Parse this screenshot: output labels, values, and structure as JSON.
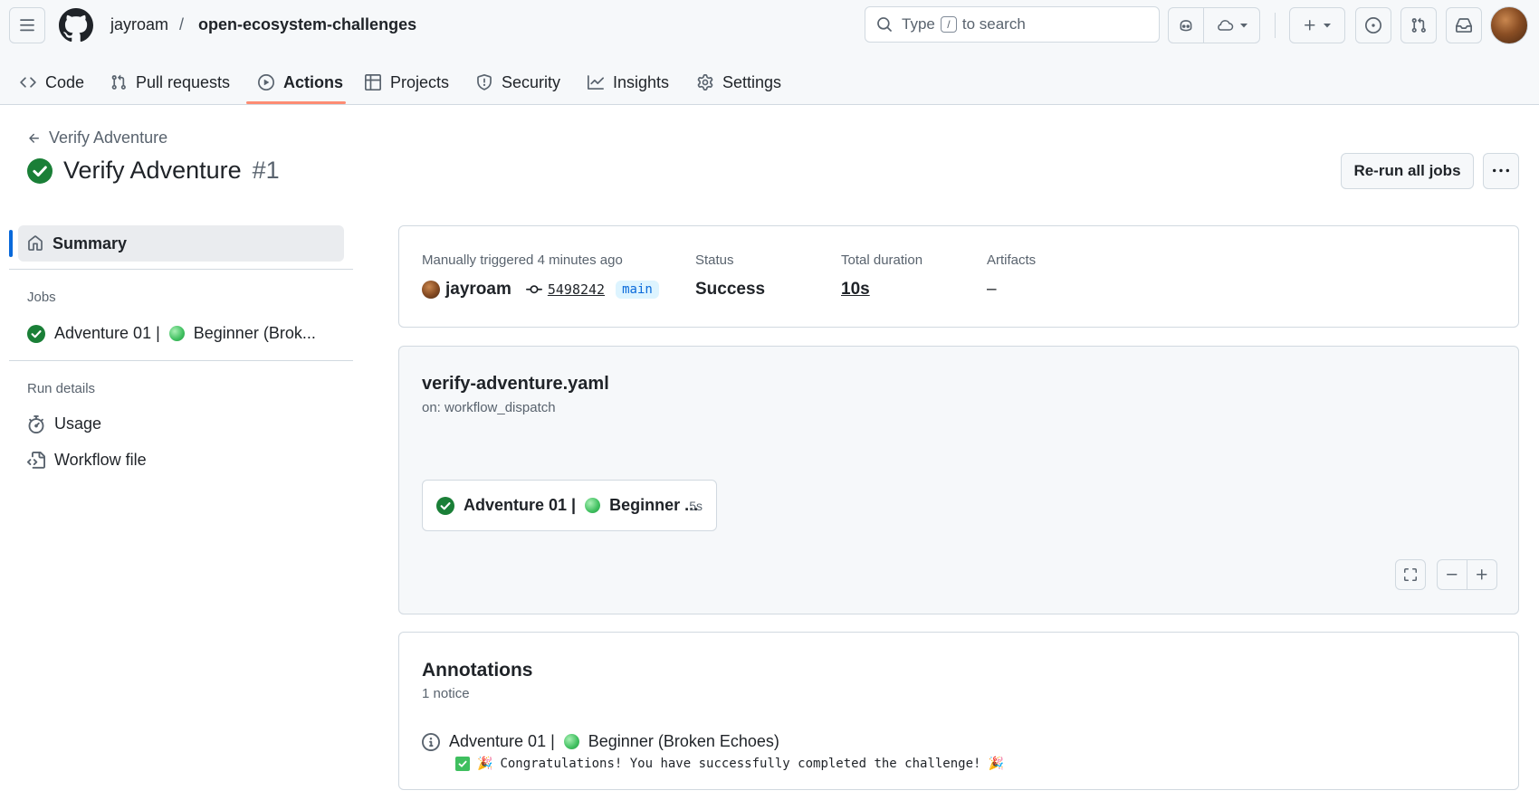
{
  "header": {
    "owner": "jayroam",
    "separator": "/",
    "repo": "open-ecosystem-challenges",
    "search": {
      "prefix": "Type",
      "key": "/",
      "suffix": "to search"
    }
  },
  "nav": {
    "tabs": [
      {
        "label": "Code",
        "icon": "code-icon"
      },
      {
        "label": "Pull requests",
        "icon": "git-pull-request-icon"
      },
      {
        "label": "Actions",
        "icon": "play-icon",
        "active": true
      },
      {
        "label": "Projects",
        "icon": "table-icon"
      },
      {
        "label": "Security",
        "icon": "shield-icon"
      },
      {
        "label": "Insights",
        "icon": "graph-icon"
      },
      {
        "label": "Settings",
        "icon": "gear-icon"
      }
    ]
  },
  "run": {
    "back_label": "Verify Adventure",
    "title": "Verify Adventure",
    "number": "#1",
    "rerun_label": "Re-run all jobs"
  },
  "sidebar": {
    "summary_label": "Summary",
    "jobs_heading": "Jobs",
    "job": {
      "prefix": "Adventure 01 |",
      "suffix": "Beginner (Brok..."
    },
    "run_details_heading": "Run details",
    "usage_label": "Usage",
    "workflow_file_label": "Workflow file"
  },
  "meta": {
    "trigger_label": "Manually triggered 4 minutes ago",
    "actor": "jayroam",
    "commit_sha": "5498242",
    "branch": "main",
    "status_label": "Status",
    "status_value": "Success",
    "duration_label": "Total duration",
    "duration_value": "10s",
    "artifacts_label": "Artifacts",
    "artifacts_value": "–"
  },
  "graph": {
    "workflow_file": "verify-adventure.yaml",
    "trigger": "on: workflow_dispatch",
    "job": {
      "prefix": "Adventure 01 |",
      "suffix": "Beginner ...",
      "duration": "5s"
    }
  },
  "annotations": {
    "title": "Annotations",
    "count": "1 notice",
    "item": {
      "prefix": "Adventure 01 |",
      "suffix": "Beginner (Broken Echoes)",
      "message": "Congratulations! You have successfully completed the challenge!"
    }
  },
  "colors": {
    "success": "#1a7f37",
    "accent": "#0969da",
    "tab_underline": "#fd8c73",
    "border": "#d1d9e0"
  }
}
